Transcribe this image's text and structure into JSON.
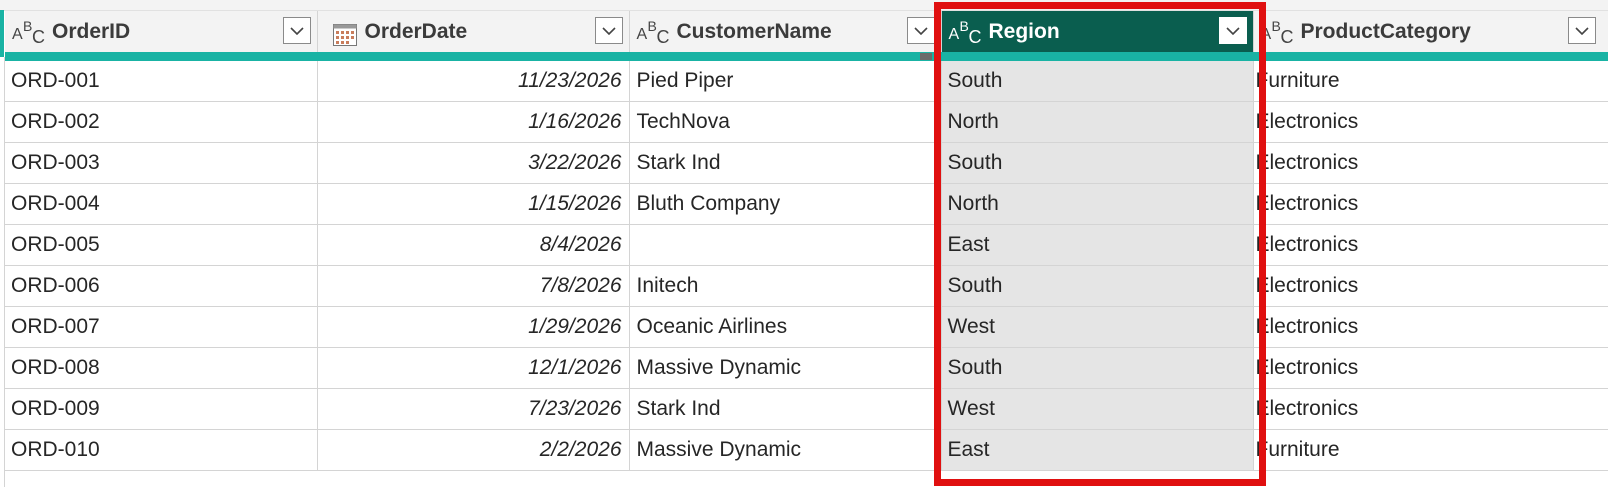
{
  "colors": {
    "header_bg": "#f3f3f3",
    "quality_bar": "#19b3a4",
    "selected_header": "#0a5e4f",
    "selected_cells": "#e5e5e5",
    "highlight_outline": "#e01010"
  },
  "columns": [
    {
      "name": "OrderID",
      "type_icon": "abc-text-icon"
    },
    {
      "name": "OrderDate",
      "type_icon": "calendar-date-icon"
    },
    {
      "name": "CustomerName",
      "type_icon": "abc-text-icon"
    },
    {
      "name": "Region",
      "type_icon": "abc-text-icon",
      "selected": true
    },
    {
      "name": "ProductCategory",
      "type_icon": "abc-text-icon"
    }
  ],
  "rows": [
    {
      "order_id": "ORD-001",
      "order_date": "11/23/2026",
      "customer": "Pied Piper",
      "region": "South",
      "category": "Furniture"
    },
    {
      "order_id": "ORD-002",
      "order_date": "1/16/2026",
      "customer": "TechNova",
      "region": "North",
      "category": "Electronics"
    },
    {
      "order_id": "ORD-003",
      "order_date": "3/22/2026",
      "customer": "Stark Ind",
      "region": "South",
      "category": "Electronics"
    },
    {
      "order_id": "ORD-004",
      "order_date": "1/15/2026",
      "customer": "Bluth Company",
      "region": "North",
      "category": "Electronics"
    },
    {
      "order_id": "ORD-005",
      "order_date": "8/4/2026",
      "customer": "",
      "region": "East",
      "category": "Electronics"
    },
    {
      "order_id": "ORD-006",
      "order_date": "7/8/2026",
      "customer": "Initech",
      "region": "South",
      "category": "Electronics"
    },
    {
      "order_id": "ORD-007",
      "order_date": "1/29/2026",
      "customer": "Oceanic Airlines",
      "region": "West",
      "category": "Electronics"
    },
    {
      "order_id": "ORD-008",
      "order_date": "12/1/2026",
      "customer": "Massive Dynamic",
      "region": "South",
      "category": "Electronics"
    },
    {
      "order_id": "ORD-009",
      "order_date": "7/23/2026",
      "customer": "Stark Ind",
      "region": "West",
      "category": "Electronics"
    },
    {
      "order_id": "ORD-010",
      "order_date": "2/2/2026",
      "customer": "Massive Dynamic",
      "region": "East",
      "category": "Furniture"
    }
  ]
}
